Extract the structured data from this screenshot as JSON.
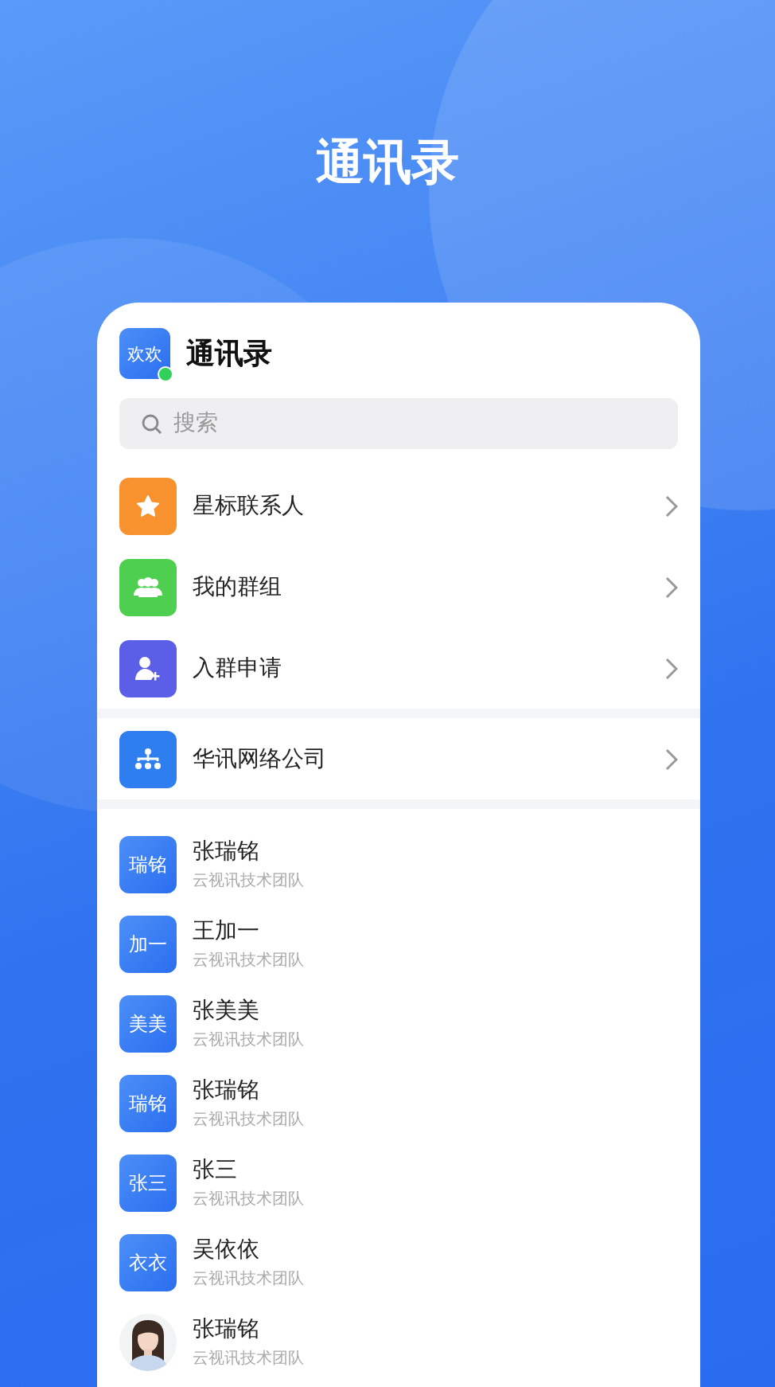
{
  "headline": "通讯录",
  "header": {
    "avatar_text": "欢欢",
    "online": true,
    "title": "通讯录"
  },
  "search": {
    "placeholder": "搜索"
  },
  "menu": [
    {
      "label": "星标联系人",
      "kind": "star",
      "color": "#f7922e"
    },
    {
      "label": "我的群组",
      "kind": "group",
      "color": "#4fcf4f"
    },
    {
      "label": "入群申请",
      "kind": "join",
      "color": "#5b5ee6"
    }
  ],
  "organization": {
    "label": "华讯网络公司",
    "kind": "org",
    "color": "#2f7ef0"
  },
  "contacts": [
    {
      "avatar_text": "瑞铭",
      "name": "张瑞铭",
      "team": "云视讯技术团队"
    },
    {
      "avatar_text": "加一",
      "name": "王加一",
      "team": "云视讯技术团队"
    },
    {
      "avatar_text": "美美",
      "name": "张美美",
      "team": "云视讯技术团队"
    },
    {
      "avatar_text": "瑞铭",
      "name": "张瑞铭",
      "team": "云视讯技术团队"
    },
    {
      "avatar_text": "张三",
      "name": "张三",
      "team": "云视讯技术团队"
    },
    {
      "avatar_text": "衣衣",
      "name": "吴依依",
      "team": "云视讯技术团队"
    },
    {
      "kind": "picture",
      "name": "张瑞铭",
      "team": "云视讯技术团队"
    }
  ]
}
